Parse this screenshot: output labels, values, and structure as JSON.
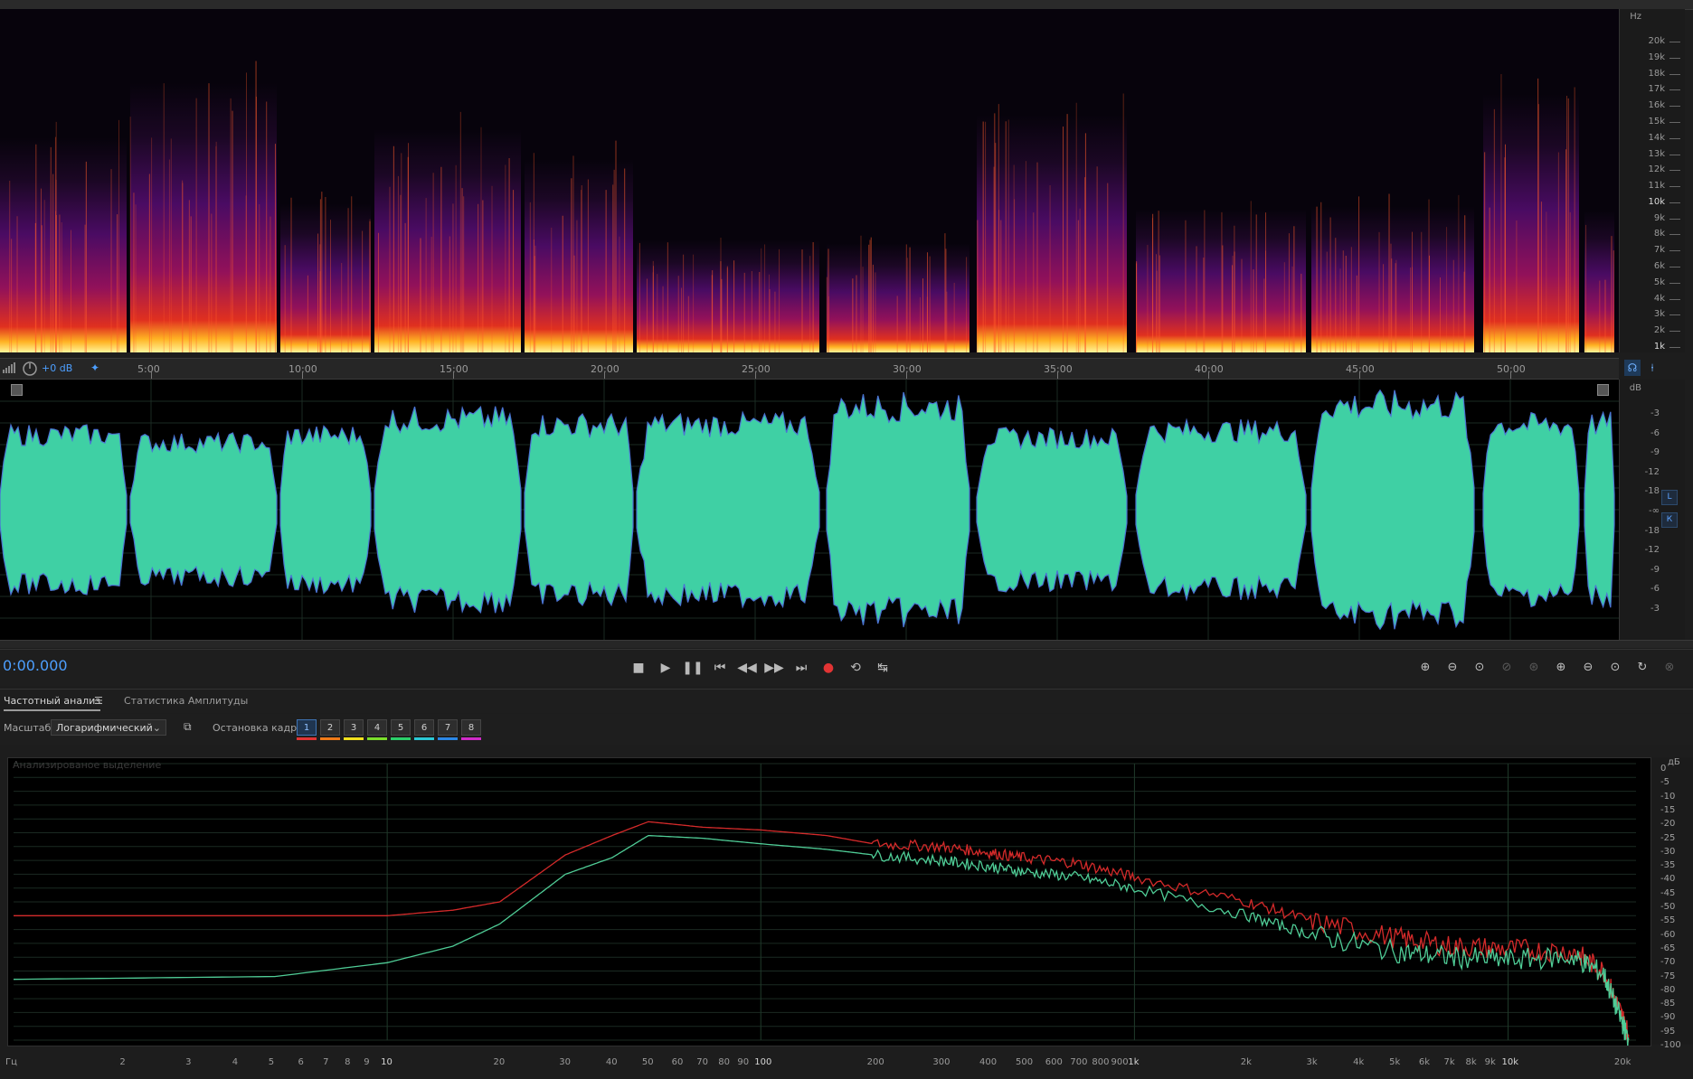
{
  "spectrogram": {
    "hz_label": "Hz",
    "freq_labels": [
      "20k",
      "19k",
      "18k",
      "17k",
      "16k",
      "15k",
      "14k",
      "13k",
      "12k",
      "11k",
      "10k",
      "9k",
      "8k",
      "7k",
      "6k",
      "5k",
      "4k",
      "3k",
      "2k",
      "1k"
    ]
  },
  "timeline": {
    "gain_label": "+0 dB",
    "time_labels": [
      "5:00",
      "10:00",
      "15:00",
      "20:00",
      "25:00",
      "30:00",
      "35:00",
      "40:00",
      "45:00",
      "50:00"
    ]
  },
  "waveform": {
    "db_label": "dB",
    "db_scale": [
      "-3",
      "-6",
      "-9",
      "-12",
      "-18",
      "-∞",
      "-18",
      "-12",
      "-9",
      "-6",
      "-3"
    ],
    "channels": [
      "L",
      "R"
    ],
    "channel_labels": {
      "left": "L",
      "right": "К"
    },
    "colors": {
      "wave": "#3fd0a4",
      "edge": "#4b74d4"
    }
  },
  "transport": {
    "timecode": "0:00.000"
  },
  "panel": {
    "tabs": [
      "Частотный анализ",
      "Статистика Амплитуды"
    ],
    "scale_label": "Масштаб:",
    "scale_value": "Логарифмический",
    "freeze_label": "Остановка кадра:",
    "frames": [
      "1",
      "2",
      "3",
      "4",
      "5",
      "6",
      "7",
      "8"
    ],
    "frame_colors": [
      "#e23434",
      "#f07a18",
      "#f2e11d",
      "#7bdf2b",
      "#2bd06a",
      "#2bc9d6",
      "#2b87e6",
      "#d02bc9"
    ],
    "caption": "Анализированое выделение"
  },
  "chart_data": {
    "type": "line",
    "title": "",
    "xlabel": "Гц",
    "ylabel": "дБ",
    "x_scale": "log",
    "xlim": [
      1,
      22000
    ],
    "ylim": [
      -100,
      0
    ],
    "grid": true,
    "x_ticks": [
      "Гц",
      "2",
      "3",
      "4",
      "5",
      "6",
      "7",
      "8",
      "9",
      "10",
      "20",
      "30",
      "40",
      "50",
      "60",
      "70",
      "80",
      "90",
      "100",
      "200",
      "300",
      "400",
      "500",
      "600",
      "700",
      "800",
      "900",
      "1k",
      "2k",
      "3k",
      "4k",
      "5k",
      "6k",
      "7k",
      "8k",
      "9k",
      "10k",
      "20k"
    ],
    "y_ticks": [
      "0",
      "-5",
      "-10",
      "-15",
      "-20",
      "-25",
      "-30",
      "-35",
      "-40",
      "-45",
      "-50",
      "-55",
      "-60",
      "-65",
      "-70",
      "-75",
      "-80",
      "-85",
      "-90",
      "-95",
      "-100"
    ],
    "series": [
      {
        "color": "#d42a2a",
        "x": [
          1,
          5,
          10,
          15,
          20,
          30,
          40,
          50,
          70,
          100,
          150,
          200,
          300,
          400,
          500,
          700,
          1000,
          2000,
          3000,
          5000,
          7000,
          10000,
          15000,
          18000,
          20000,
          21000
        ],
        "values": [
          -55,
          -55,
          -55,
          -53,
          -50,
          -33,
          -26,
          -21,
          -23,
          -24,
          -26,
          -29,
          -30,
          -32,
          -34,
          -36,
          -41,
          -50,
          -57,
          -63,
          -66,
          -67,
          -68,
          -75,
          -90,
          -98
        ]
      },
      {
        "color": "#4fcc96",
        "x": [
          1,
          5,
          10,
          15,
          20,
          30,
          40,
          50,
          70,
          100,
          150,
          200,
          300,
          400,
          500,
          700,
          1000,
          2000,
          3000,
          5000,
          7000,
          10000,
          15000,
          18000,
          20000,
          21000
        ],
        "values": [
          -78,
          -77,
          -72,
          -66,
          -58,
          -40,
          -34,
          -26,
          -27,
          -29,
          -31,
          -33,
          -35,
          -37,
          -39,
          -41,
          -45,
          -55,
          -62,
          -68,
          -70,
          -71,
          -70,
          -76,
          -92,
          -100
        ]
      }
    ]
  }
}
